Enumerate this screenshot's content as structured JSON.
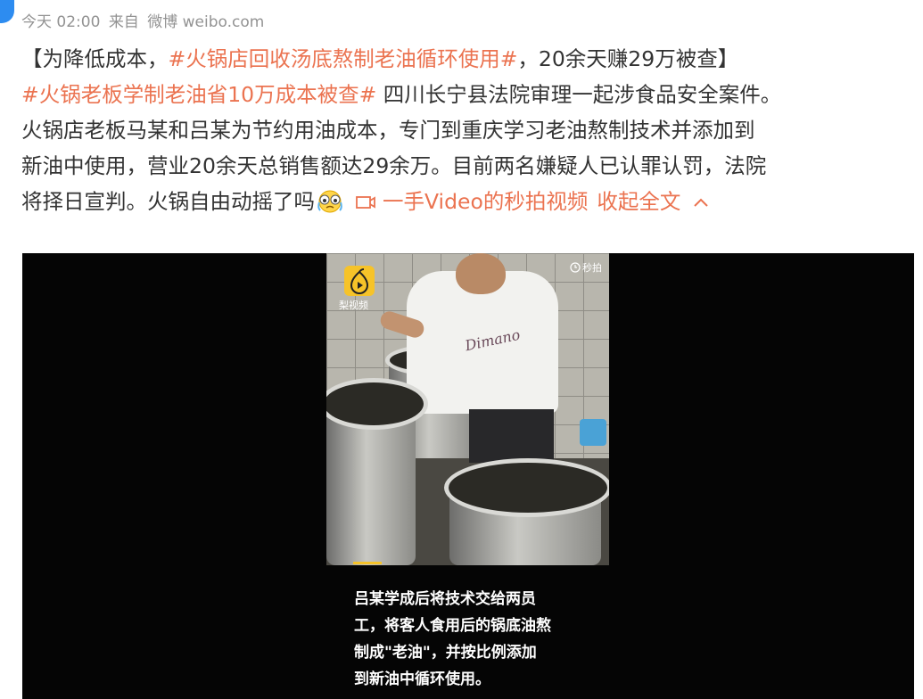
{
  "meta": {
    "time": "今天 02:00",
    "source_prefix": "来自",
    "source": "微博 weibo.com"
  },
  "post": {
    "line1": {
      "open_bracket": "【为降低成本，",
      "topic": "#火锅店回收汤底熬制老油循环使用#",
      "rest": "，20余天赚29万被查】"
    },
    "line2": {
      "topic": "#火锅老板学制老油省10万成本被查#",
      "rest": " 四川长宁县法院审理一起涉食品安全案件。"
    },
    "line3": "火锅店老板马某和吕某为节约用油成本，专门到重庆学习老油熬制技术并添加到",
    "line4": "新油中使用，营业20余天总销售额达29余万。目前两名嫌疑人已认罪认罚，法院",
    "line5": {
      "text": "将择日宣判。火锅自由动摇了吗",
      "emoji": "tear-face-icon",
      "video_link": "一手Video的秒拍视频",
      "collapse": "收起全文"
    }
  },
  "video": {
    "logo_label": "梨视频",
    "badge": "秒拍",
    "shirt_print": "Dimano",
    "caption": [
      "吕某学成后将技术交给两员",
      "工，将客人食用后的锅底油熬",
      "制成\"老油\"，并按比例添加",
      "到新油中循环使用。"
    ],
    "progress": 0.1
  },
  "colors": {
    "link": "#eb7350",
    "text": "#333333",
    "meta": "#939393",
    "logo": "#f6c329"
  }
}
